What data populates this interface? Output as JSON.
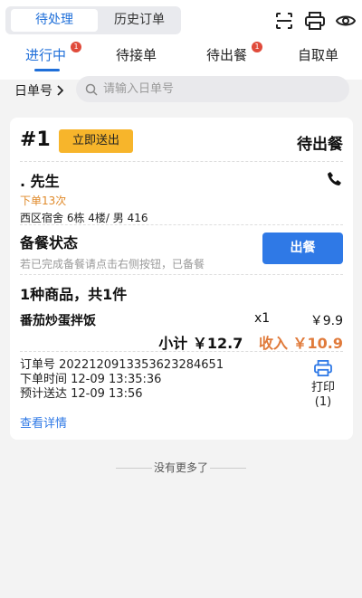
{
  "segment": {
    "active": "待处理",
    "inactive": "历史订单"
  },
  "tabs": [
    {
      "label": "进行中",
      "badge": "1"
    },
    {
      "label": "待接单",
      "badge": ""
    },
    {
      "label": "待出餐",
      "badge": "1"
    },
    {
      "label": "自取单",
      "badge": ""
    }
  ],
  "filter": {
    "date_label": "日单号",
    "search_placeholder": "请输入日单号"
  },
  "order": {
    "number": "#1",
    "urgent_label": "立即送出",
    "status": "待出餐",
    "customer_name": ". 先生",
    "order_count": "下单13次",
    "address": "西区宿舍 6栋 4楼/ 男 416",
    "prep_title": "备餐状态",
    "prep_desc": "若已完成备餐请点击右侧按钮，已备餐",
    "serve_label": "出餐",
    "goods_summary": "1种商品，共1件",
    "items": [
      {
        "name": "番茄炒蛋拌饭",
        "qty": "x1",
        "price": "￥9.9"
      }
    ],
    "subtotal": "小计 ￥12.7",
    "income": "收入 ￥10.9",
    "order_id": "订单号 2022120913353623284651",
    "order_time": "下单时间 12-09 13:35:36",
    "eta": "预计送达 12-09 13:56",
    "print_label": "打印(1)",
    "detail_link": "查看详情"
  },
  "footer": {
    "no_more": "没有更多了"
  },
  "colors": {
    "accent": "#1f6fd9",
    "button": "#2f79e6",
    "urgent": "#f7b52b",
    "income": "#e07a3a",
    "badge": "#e04b3b"
  }
}
